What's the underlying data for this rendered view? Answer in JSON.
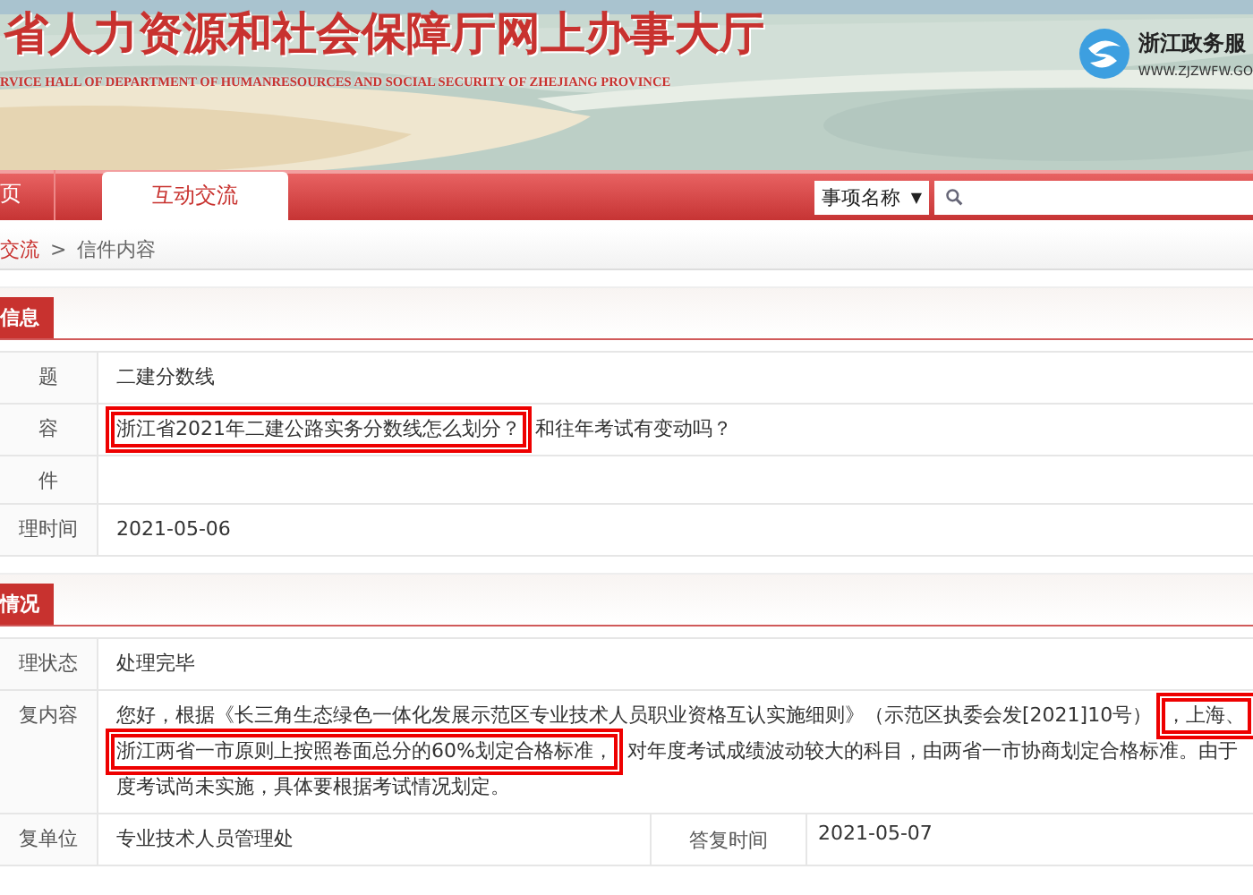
{
  "header": {
    "title": "省人力资源和社会保障厅网上办事大厅",
    "subtitle": "RVICE HALL OF DEPARTMENT OF HUMANRESOURCES AND SOCIAL SECURITY OF ZHEJIANG PROVINCE",
    "logo_name": "浙江政务服",
    "logo_url": "WWW.ZJZWFW.GO"
  },
  "nav": {
    "tabs": [
      {
        "label": "页",
        "selected": false
      },
      {
        "label": "互动交流",
        "selected": true
      }
    ],
    "search_type": "事项名称",
    "search_caret": "▼"
  },
  "breadcrumb": [
    {
      "label": "交流",
      "link": true
    },
    {
      "label": ">",
      "link": false
    },
    {
      "label": "信件内容",
      "link": false
    }
  ],
  "sections": [
    {
      "title": "信息",
      "rows": [
        {
          "label": "题",
          "lines": [
            [
              {
                "text": "二建分数线",
                "highlighted": false
              }
            ]
          ]
        },
        {
          "label": "容",
          "lines": [
            [
              {
                "text": "浙江省2021年二建公路实务分数线怎么划分？",
                "highlighted": true
              },
              {
                "text": "和往年考试有变动吗？",
                "highlighted": false
              }
            ]
          ]
        },
        {
          "label": "件",
          "lines": []
        },
        {
          "label": "理时间",
          "lines": [
            [
              {
                "text": "2021-05-06",
                "highlighted": false
              }
            ]
          ]
        }
      ]
    },
    {
      "title": "情况",
      "rows": [
        {
          "label": "理状态",
          "lines": [
            [
              {
                "text": "处理完毕",
                "highlighted": false
              }
            ]
          ]
        },
        {
          "label": "复内容",
          "lines": [
            [
              {
                "text": "您好，根据《长三角生态绿色一体化发展示范区专业技术人员职业资格互认实施细则》（示范区执委会发[2021]10号）",
                "highlighted": false
              },
              {
                "text": "，上海、",
                "highlighted": true
              }
            ],
            [
              {
                "text": "浙江两省一市原则上按照卷面总分的60%划定合格标准，",
                "highlighted": true
              },
              {
                "text": "对年度考试成绩波动较大的科目，由两省一市协商划定合格标准。由于",
                "highlighted": false
              }
            ],
            [
              {
                "text": "度考试尚未实施，具体要根据考试情况划定。",
                "highlighted": false
              }
            ]
          ]
        },
        {
          "label": "复单位",
          "lines": [
            [
              {
                "text": "专业技术人员管理处",
                "highlighted": false
              }
            ]
          ],
          "extra_label": "答复时间",
          "extra_value": "2021-05-07"
        }
      ]
    }
  ]
}
